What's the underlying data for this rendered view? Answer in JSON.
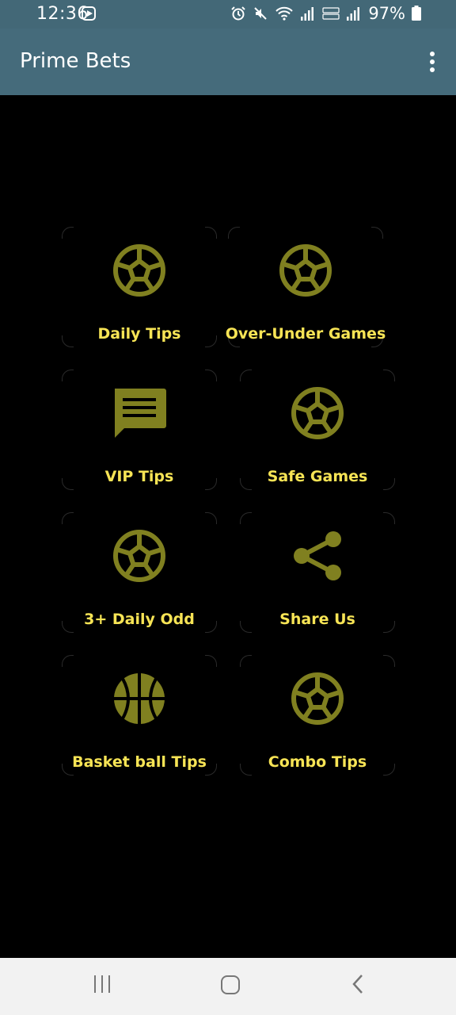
{
  "status": {
    "time": "12:36",
    "battery": "97%"
  },
  "app": {
    "title": "Prime Bets"
  },
  "tiles": [
    {
      "label": "Daily Tips",
      "icon": "soccer-ball-icon"
    },
    {
      "label": "Over-Under Games",
      "icon": "soccer-ball-icon"
    },
    {
      "label": "VIP Tips",
      "icon": "message-icon"
    },
    {
      "label": "Safe Games",
      "icon": "soccer-ball-icon"
    },
    {
      "label": "3+ Daily Odd",
      "icon": "soccer-ball-icon"
    },
    {
      "label": "Share Us",
      "icon": "share-icon"
    },
    {
      "label": "Basket ball Tips",
      "icon": "basketball-icon"
    },
    {
      "label": "Combo Tips",
      "icon": "soccer-ball-icon"
    }
  ],
  "colors": {
    "appbar": "#456b7b",
    "icon": "#808020",
    "label": "#f7e455",
    "background": "#000000"
  }
}
